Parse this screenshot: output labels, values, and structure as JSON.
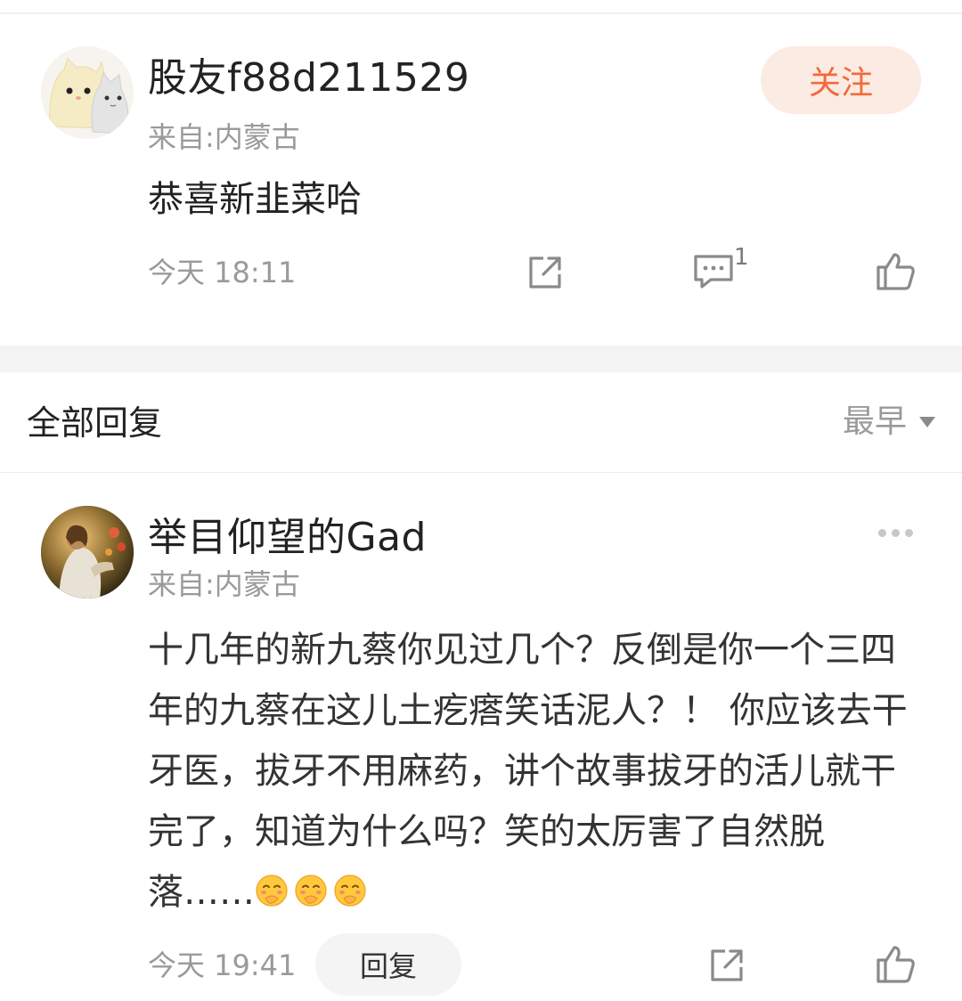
{
  "comment": {
    "username": "股友f88d211529",
    "origin": "来自:内蒙古",
    "text": "恭喜新韭菜哈",
    "time": "今天 18:11",
    "follow_label": "关注",
    "comment_count": "1",
    "icons": [
      "share-icon",
      "comment-icon",
      "like-icon"
    ]
  },
  "replies_header": {
    "title": "全部回复",
    "sort_label": "最早"
  },
  "reply": {
    "username": "举目仰望的Gad",
    "origin": "来自:内蒙古",
    "text": "十几年的新九蔡你见过几个？反倒是你一个三四年的九蔡在这儿土疙瘩笑话泥人？！ 你应该去干牙医，拔牙不用麻药，讲个故事拔牙的活儿就干完了，知道为什么吗？笑的太厉害了自然脱落……",
    "emoji": [
      "shy-laugh-emoji",
      "shy-laugh-emoji",
      "shy-laugh-emoji"
    ],
    "time": "今天 19:41",
    "reply_label": "回复",
    "icons": [
      "more-icon",
      "share-icon",
      "like-icon"
    ]
  },
  "colors": {
    "accent": "#f26a3a",
    "follow_bg": "#fcebe3",
    "muted_text": "#9a9a9a"
  }
}
